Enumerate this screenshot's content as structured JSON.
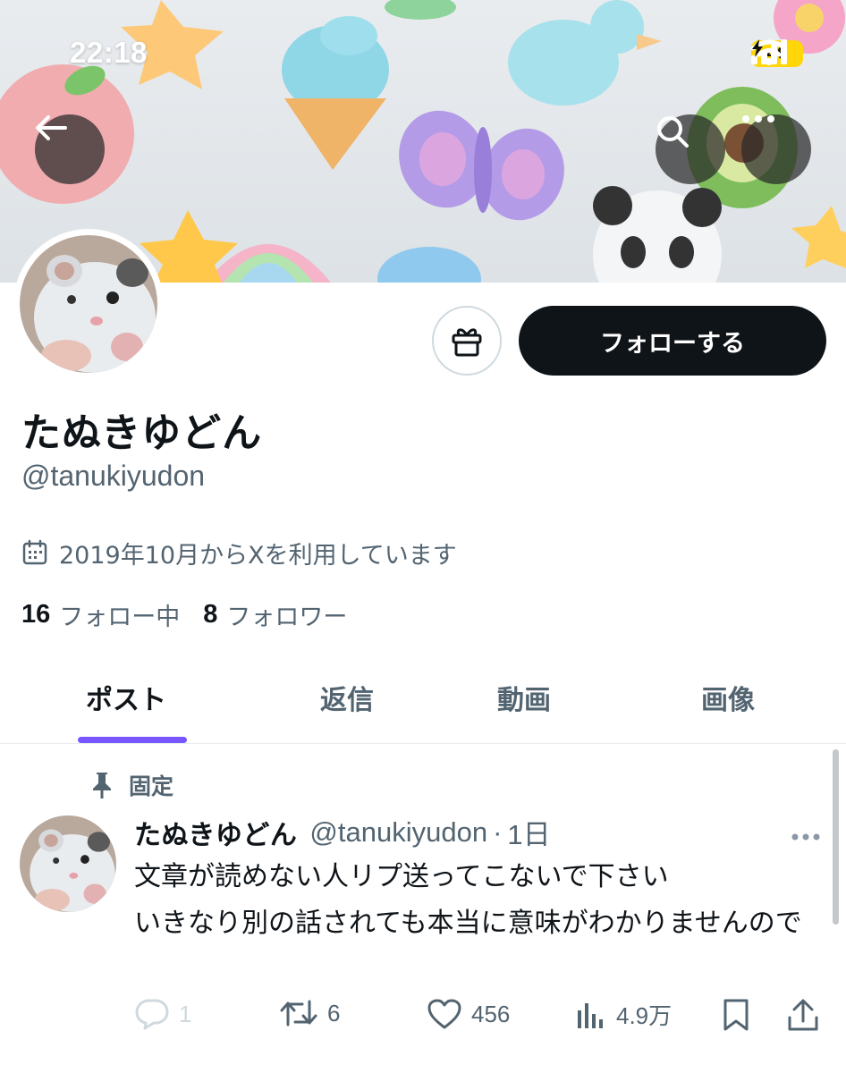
{
  "status_bar": {
    "time": "22:18",
    "battery": "46"
  },
  "profile": {
    "display_name": "たぬきゆどん",
    "handle": "@tanukiyudon",
    "joined": "2019年10月からXを利用しています",
    "following_count": "16",
    "following_label": "フォロー中",
    "followers_count": "8",
    "followers_label": "フォロワー",
    "follow_button": "フォローする"
  },
  "tabs": [
    {
      "label": "ポスト",
      "active": true
    },
    {
      "label": "返信",
      "active": false
    },
    {
      "label": "動画",
      "active": false
    },
    {
      "label": "画像",
      "active": false
    }
  ],
  "post": {
    "pinned_label": "固定",
    "author_name": "たぬきゆどん",
    "author_handle": "@tanukiyudon",
    "time_sep": "·",
    "time": "1日",
    "text": "文章が読めない人リプ送ってこないで下さい\nいきなり別の話されても本当に意味がわかりませんので",
    "replies": "1",
    "reposts": "6",
    "likes": "456",
    "views": "4.9万"
  },
  "colors": {
    "accent": "#7856ff",
    "text_primary": "#0f1419",
    "text_secondary": "#536471",
    "battery": "#ffd60a"
  },
  "icons": [
    "back-arrow-icon",
    "search-icon",
    "more-icon",
    "gift-icon",
    "calendar-icon",
    "pin-icon",
    "reply-icon",
    "repost-icon",
    "like-icon",
    "views-icon",
    "bookmark-icon",
    "share-icon"
  ]
}
